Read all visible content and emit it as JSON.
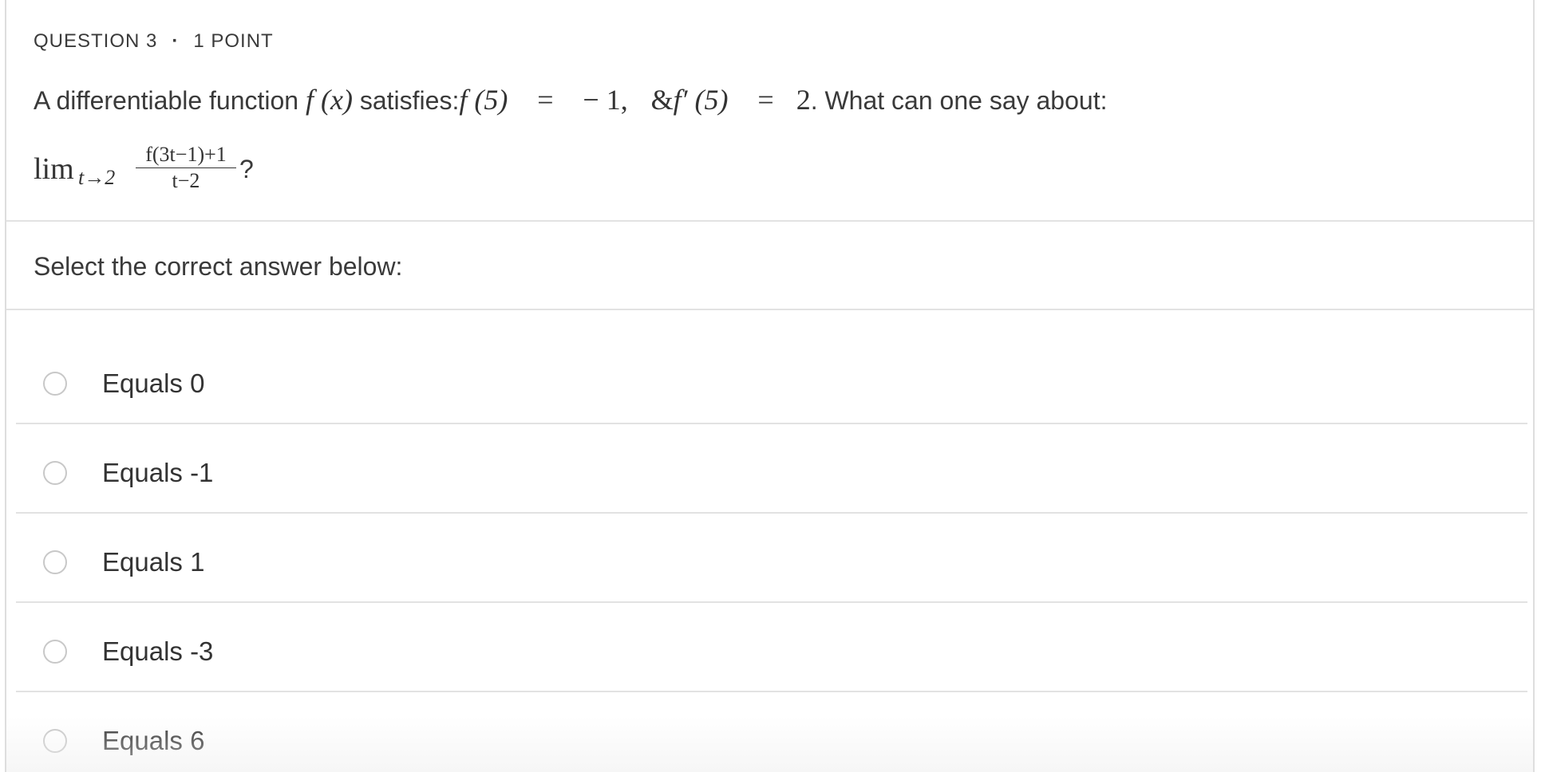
{
  "question": {
    "number_label": "QUESTION 3",
    "separator": "·",
    "points_label": "1 POINT",
    "prompt_prefix": "A differentiable function",
    "prompt_func": "f (x)",
    "prompt_mid": "satisfies:",
    "prompt_cond1_lhs": "f (5)",
    "prompt_eq": "=",
    "prompt_cond1_rhs": "− 1,",
    "prompt_amp": "&",
    "prompt_cond2_lhs": "f′ (5)",
    "prompt_cond2_rhs": "2",
    "prompt_suffix": ". What can one say about:",
    "limit": {
      "lim_word": "lim",
      "subscript": "t→2",
      "numerator": "f(3t−1)+1",
      "denominator": "t−2",
      "question_mark": "?"
    }
  },
  "instructions": "Select the correct answer below:",
  "options": [
    {
      "label": "Equals 0",
      "selected": false
    },
    {
      "label": "Equals -1",
      "selected": false
    },
    {
      "label": "Equals 1",
      "selected": false
    },
    {
      "label": "Equals -3",
      "selected": false
    },
    {
      "label": "Equals 6",
      "selected": false
    }
  ],
  "colors": {
    "text": "#3a3a3a",
    "divider": "#e2e2e2",
    "radio_border": "#c8c8c8",
    "background": "#ffffff"
  }
}
